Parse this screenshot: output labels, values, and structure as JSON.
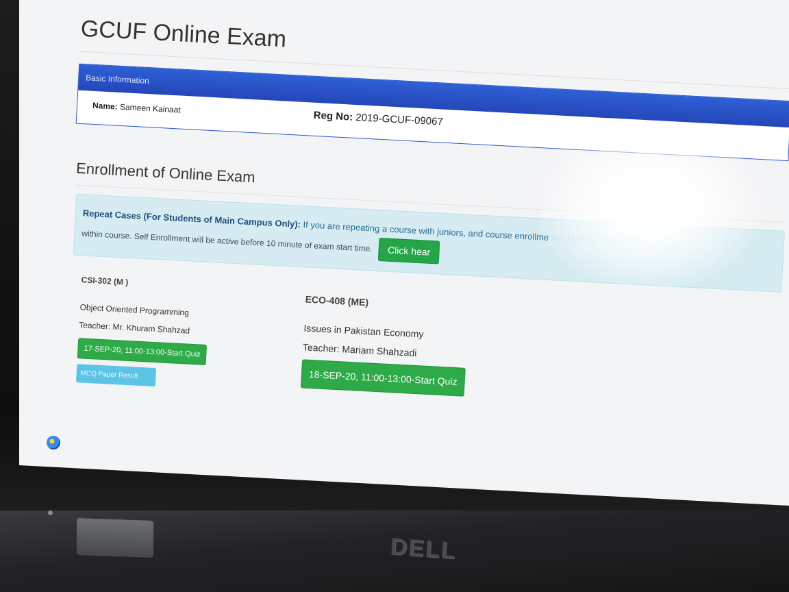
{
  "header": {
    "title": "GCUF Online Exam"
  },
  "basic_info": {
    "heading": "Basic Information",
    "name_label": "Name:",
    "name_value": "Sameen Kainaat",
    "reg_label": "Reg No:",
    "reg_value": "2019-GCUF-09067"
  },
  "enrollment": {
    "heading": "Enrollment of Online Exam",
    "alert": {
      "strong": "Repeat Cases (For Students of Main Campus Only):",
      "text": " If you are repeating a course with juniors, and course enrollme",
      "text_tail": "isted below, please click",
      "line2": "within course. Self Enrollment will be active before 10 minute of exam start time.",
      "button": "Click hear"
    },
    "courses": [
      {
        "code": "CSI-302 (M )",
        "name": "Object Oriented Programming",
        "teacher": "Teacher: Mr. Khuram Shahzad",
        "quiz_button": "17-SEP-20, 11:00-13:00-Start Quiz",
        "result_button": "MCQ Paper Result"
      },
      {
        "code": "ECO-408 (ME)",
        "name": "Issues in Pakistan Economy",
        "teacher": "Teacher: Mariam Shahzadi",
        "quiz_button": "18-SEP-20, 11:00-13:00-Start Quiz"
      }
    ]
  },
  "laptop": {
    "brand": "DELL"
  },
  "colors": {
    "panel_blue": "#2447b8",
    "quiz_green": "#2eaa48",
    "result_cyan": "#5cc5e6",
    "alert_bg": "#d6ecf2"
  }
}
